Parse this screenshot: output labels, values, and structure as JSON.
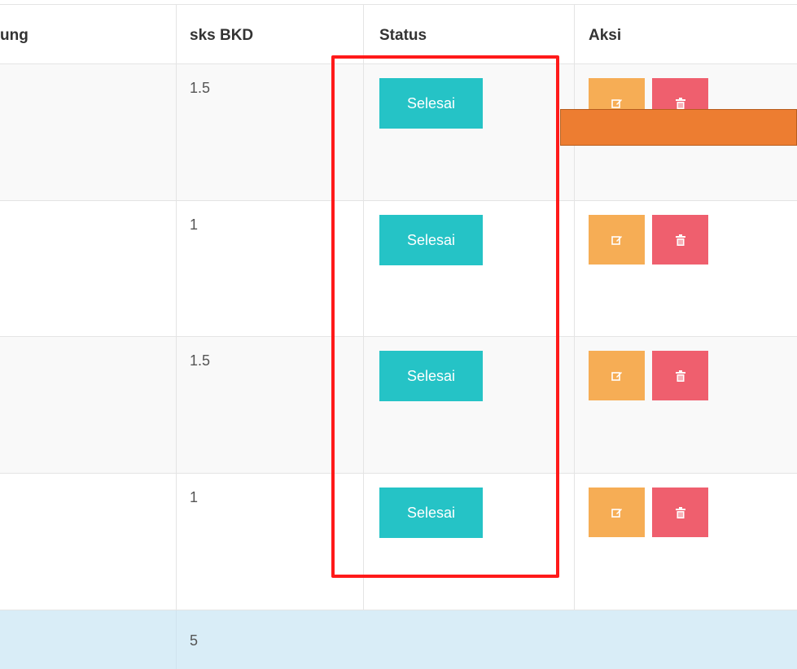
{
  "table": {
    "headers": {
      "col1": "ung",
      "sks_bkd": "sks BKD",
      "status": "Status",
      "aksi": "Aksi"
    },
    "rows": [
      {
        "sks": "1.5",
        "status": "Selesai"
      },
      {
        "sks": "1",
        "status": "Selesai"
      },
      {
        "sks": "1.5",
        "status": "Selesai"
      },
      {
        "sks": "1",
        "status": "Selesai"
      }
    ],
    "total_sks": "5"
  },
  "icons": {
    "edit": "edit-icon",
    "delete": "trash-icon"
  },
  "colors": {
    "status_badge": "#25c3c6",
    "edit_button": "#f6ad55",
    "delete_button": "#ef5f6e",
    "highlight_border": "#ff1a1a",
    "annotation_bar": "#ed7d31",
    "total_row": "#d9edf7"
  }
}
